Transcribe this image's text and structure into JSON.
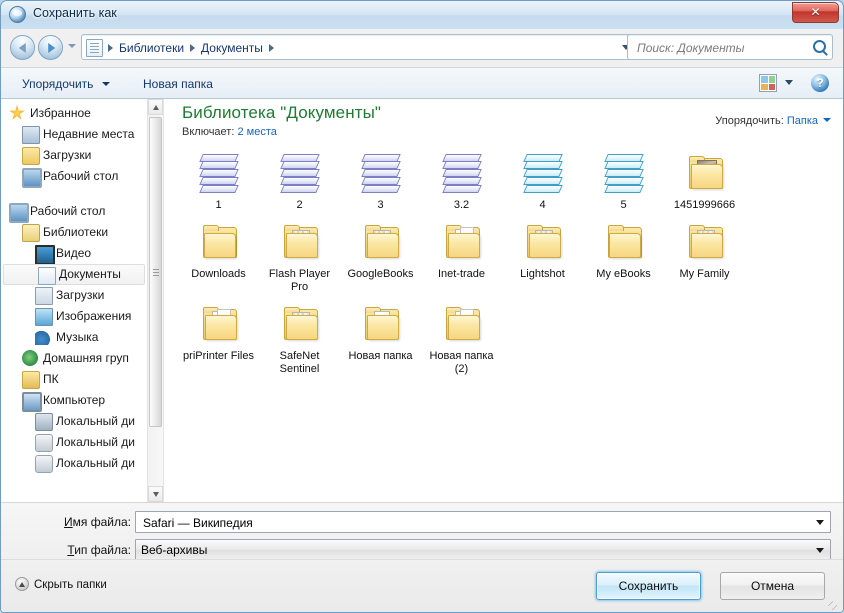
{
  "window": {
    "title": "Сохранить как",
    "close_label": "✕"
  },
  "nav": {
    "back_title": "Назад",
    "forward_title": "Вперёд",
    "breadcrumbs": [
      "Библиотеки",
      "Документы"
    ],
    "search_placeholder": "Поиск: Документы",
    "search_value": ""
  },
  "toolbar": {
    "organize": "Упорядочить",
    "new_folder": "Новая папка"
  },
  "sidebar": {
    "groups": [
      {
        "items": [
          {
            "label": "Избранное",
            "icon": "star-icon",
            "indent": 0
          },
          {
            "label": "Недавние места",
            "icon": "recent-places-icon",
            "indent": 1
          },
          {
            "label": "Загрузки",
            "icon": "downloads-icon",
            "indent": 1
          },
          {
            "label": "Рабочий стол",
            "icon": "desktop-icon",
            "indent": 1
          }
        ]
      },
      {
        "items": [
          {
            "label": "Рабочий стол",
            "icon": "desktop-icon",
            "indent": 0
          },
          {
            "label": "Библиотеки",
            "icon": "libraries-icon",
            "indent": 1
          },
          {
            "label": "Видео",
            "icon": "video-icon",
            "indent": 2
          },
          {
            "label": "Документы",
            "icon": "documents-icon",
            "indent": 2,
            "selected": true
          },
          {
            "label": "Загрузки",
            "icon": "downloads-lib-icon",
            "indent": 2
          },
          {
            "label": "Изображения",
            "icon": "pictures-icon",
            "indent": 2
          },
          {
            "label": "Музыка",
            "icon": "music-icon",
            "indent": 2
          },
          {
            "label": "Домашняя груп",
            "icon": "homegroup-icon",
            "indent": 1
          },
          {
            "label": "ПК",
            "icon": "user-folder-icon",
            "indent": 1
          },
          {
            "label": "Компьютер",
            "icon": "computer-icon",
            "indent": 1
          },
          {
            "label": "Локальный ди",
            "icon": "system-drive-icon",
            "indent": 2
          },
          {
            "label": "Локальный ди",
            "icon": "drive-icon",
            "indent": 2
          },
          {
            "label": "Локальный ди",
            "icon": "drive-icon",
            "indent": 2
          }
        ]
      }
    ]
  },
  "library": {
    "title": "Библиотека \"Документы\"",
    "includes_label": "Включает:",
    "includes_value": "2 места",
    "arrange_label": "Упорядочить:",
    "arrange_value": "Папка"
  },
  "files": [
    {
      "name": "1",
      "icon": "stack-purple-icon"
    },
    {
      "name": "2",
      "icon": "stack-purple-icon"
    },
    {
      "name": "3",
      "icon": "stack-purple-icon"
    },
    {
      "name": "3.2",
      "icon": "stack-purple-icon"
    },
    {
      "name": "4",
      "icon": "stack-cyan-icon"
    },
    {
      "name": "5",
      "icon": "stack-cyan-icon"
    },
    {
      "name": "1451999666",
      "icon": "folder-thumbnail-icon"
    },
    {
      "name": "Downloads",
      "icon": "folder-empty-icon"
    },
    {
      "name": "Flash Player Pro",
      "icon": "folder-docs-icon"
    },
    {
      "name": "GoogleBooks",
      "icon": "folder-docs-icon"
    },
    {
      "name": "Inet-trade",
      "icon": "folder-papers-icon"
    },
    {
      "name": "Lightshot",
      "icon": "folder-docs-icon"
    },
    {
      "name": "My eBooks",
      "icon": "folder-empty-icon"
    },
    {
      "name": "My Family",
      "icon": "folder-docs-icon"
    },
    {
      "name": "priPrinter Files",
      "icon": "folder-papers-icon"
    },
    {
      "name": "SafeNet Sentinel",
      "icon": "folder-docs-icon"
    },
    {
      "name": "Новая папка",
      "icon": "folder-small-item-icon"
    },
    {
      "name": "Новая папка (2)",
      "icon": "folder-papers-icon"
    }
  ],
  "form": {
    "filename_label_pre": "И",
    "filename_label_post": "мя файла:",
    "filename_value": "Safari — Википедия",
    "filetype_label_pre": "Т",
    "filetype_label_post": "ип файла:",
    "filetype_value": "Веб-архивы"
  },
  "footer": {
    "hide_folders": "Скрыть папки",
    "save": "Сохранить",
    "cancel": "Отмена"
  }
}
